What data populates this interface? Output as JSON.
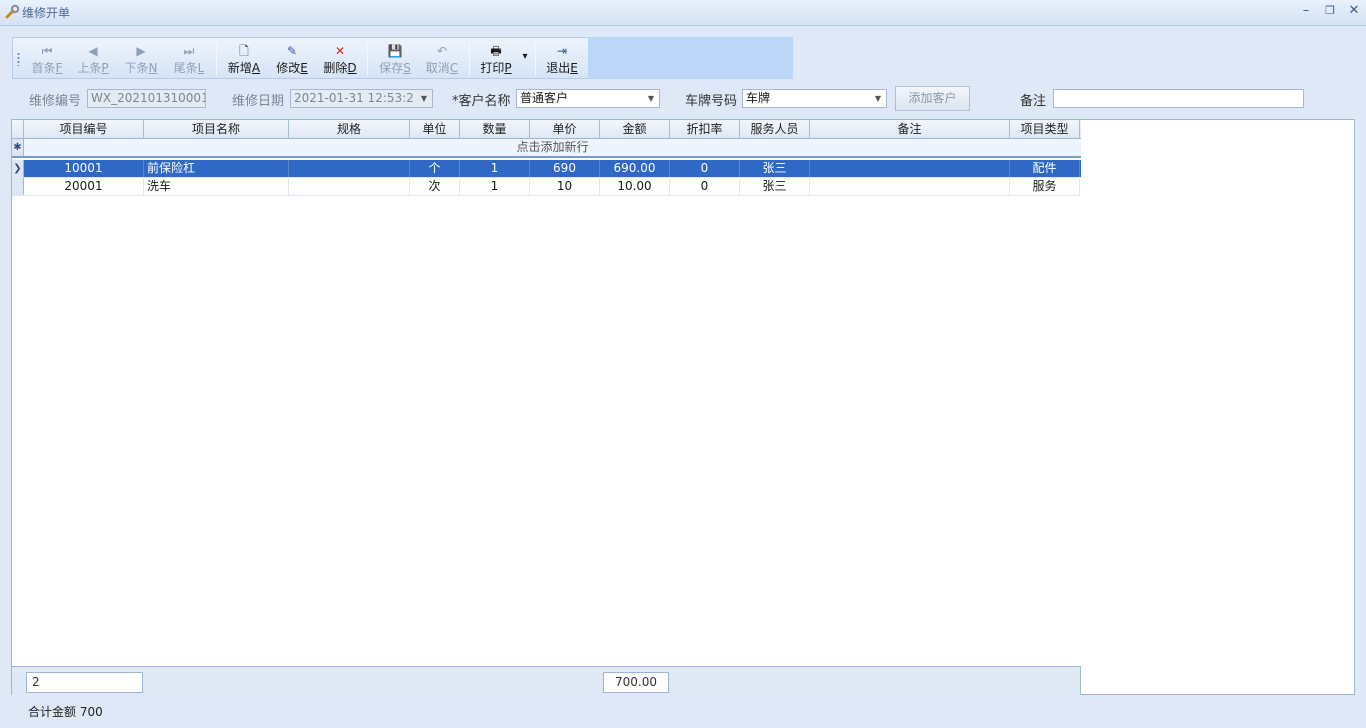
{
  "window": {
    "title": "维修开单",
    "minimize": "–",
    "restore": "❐",
    "close": "✕"
  },
  "toolbar": {
    "first": {
      "text": "首条",
      "key": "F",
      "icon": "⏮"
    },
    "prev": {
      "text": "上条",
      "key": "P",
      "icon": "◀"
    },
    "next": {
      "text": "下条",
      "key": "N",
      "icon": "▶"
    },
    "last": {
      "text": "尾条",
      "key": "L",
      "icon": "⏭"
    },
    "new": {
      "text": "新增",
      "key": "A",
      "icon": "🗋"
    },
    "edit": {
      "text": "修改",
      "key": "E",
      "icon": "✎"
    },
    "delete": {
      "text": "删除",
      "key": "D",
      "icon": "✕"
    },
    "save": {
      "text": "保存",
      "key": "S",
      "icon": "💾"
    },
    "cancel": {
      "text": "取消",
      "key": "C",
      "icon": "↶"
    },
    "print": {
      "text": "打印",
      "key": "P",
      "icon": "🖶",
      "dropdown": "▾"
    },
    "exit": {
      "text": "退出",
      "key": "E",
      "icon": "⇥"
    }
  },
  "form": {
    "order_no_label": "维修编号",
    "order_no_value": "WX_202101310001",
    "date_label": "维修日期",
    "date_value": "2021-01-31 12:53:2",
    "customer_label": "*客户名称",
    "customer_value": "普通客户",
    "plate_label": "车牌号码",
    "plate_value": "车牌",
    "add_customer": "添加客户",
    "remark_label": "备注",
    "remark_value": ""
  },
  "grid": {
    "columns": [
      "项目编号",
      "项目名称",
      "规格",
      "单位",
      "数量",
      "单价",
      "金额",
      "折扣率",
      "服务人员",
      "备注",
      "项目类型"
    ],
    "new_row_text": "点击添加新行",
    "rows": [
      [
        "10001",
        "前保险杠",
        "",
        "个",
        "1",
        "690",
        "690.00",
        "0",
        "张三",
        "",
        "配件"
      ],
      [
        "20001",
        "洗车",
        "",
        "次",
        "1",
        "10",
        "10.00",
        "0",
        "张三",
        "",
        "服务"
      ]
    ],
    "selected_row": 0,
    "row_pointer": "❯",
    "new_row_marker": "✱",
    "footer_count": "2",
    "footer_amount": "700.00"
  },
  "status": {
    "total_text": "合计金额 700"
  }
}
